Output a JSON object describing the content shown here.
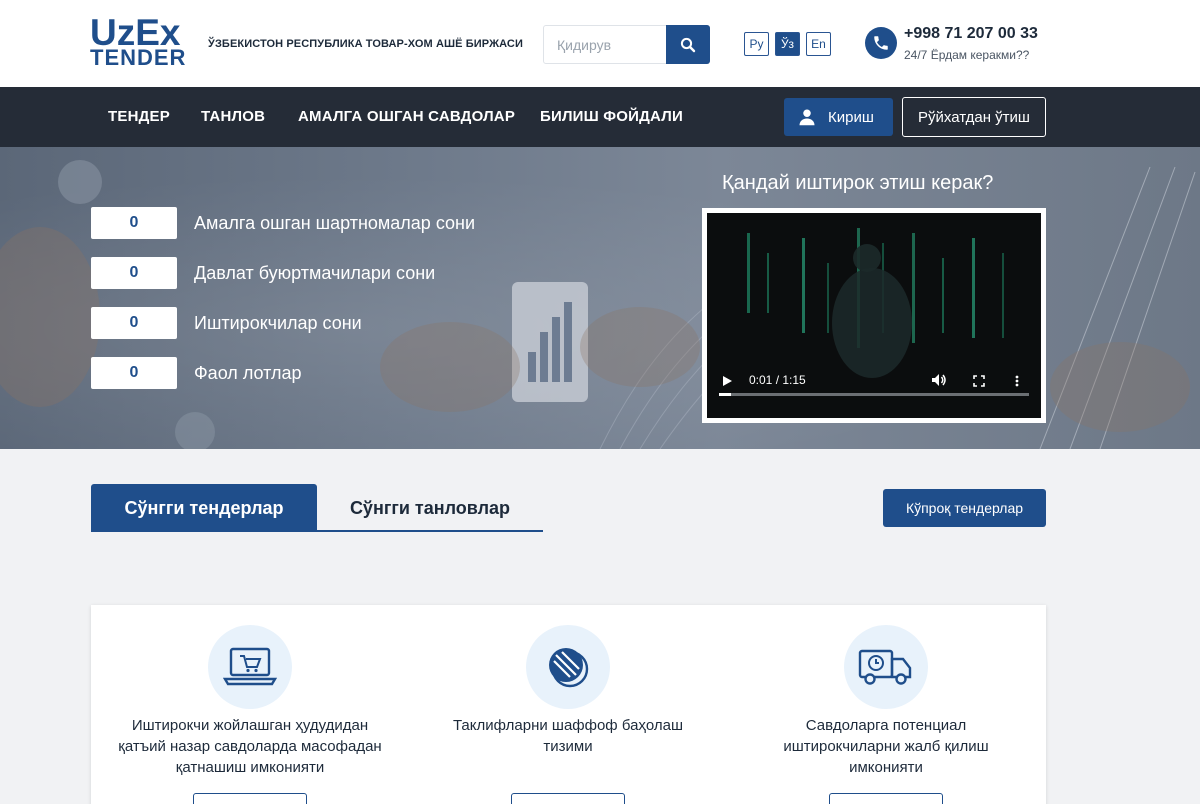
{
  "header": {
    "logo_line1": "UzEx",
    "logo_line2": "TENDER",
    "org_name": "ЎЗБЕКИСТОН РЕСПУБЛИКА ТОВАР-ХОМ АШЁ БИРЖАСИ",
    "search_placeholder": "Қидирув",
    "search_icon": "search-icon",
    "languages": [
      {
        "label": "Ру",
        "active": false
      },
      {
        "label": "Ўз",
        "active": true
      },
      {
        "label": "En",
        "active": false
      }
    ],
    "phone": "+998 71 207 00 33",
    "phone_sub": "24/7 Ёрдам керакми??",
    "phone_icon": "phone-icon"
  },
  "nav": {
    "items": [
      "ТЕНДЕР",
      "ТАНЛОВ",
      "АМАЛГА ОШГАН САВДОЛАР",
      "БИЛИШ ФОЙДАЛИ"
    ],
    "login_label": "Кириш",
    "register_label": "Рўйхатдан ўтиш"
  },
  "hero": {
    "stats": [
      {
        "value": "0",
        "label": "Амалга ошган шартномалар сони"
      },
      {
        "value": "0",
        "label": "Давлат буюртмачилари сони"
      },
      {
        "value": "0",
        "label": "Иштирокчилар сони"
      },
      {
        "value": "0",
        "label": "Фаол лотлар"
      }
    ],
    "video_title": "Қандай иштирок этиш керак?",
    "video_time": "0:01 / 1:15",
    "video_progress": 0.04
  },
  "tabs": {
    "active": "Сўнгги тендерлар",
    "other": "Сўнгги танловлар",
    "more_button": "Кўпроқ тендерлар"
  },
  "features": [
    {
      "icon": "laptop-cart-icon",
      "text": "Иштирокчи жойлашган ҳудудидан қатъий назар савдоларда масофадан қатнашиш имконияти"
    },
    {
      "icon": "transparency-icon",
      "text": "Таклифларни шаффоф баҳолаш тизими"
    },
    {
      "icon": "delivery-truck-icon",
      "text": "Савдоларга потенциал иштирокчиларни жалб қилиш имконияти"
    }
  ],
  "colors": {
    "brand": "#1f4e8b",
    "nav_bg": "#252c37"
  }
}
